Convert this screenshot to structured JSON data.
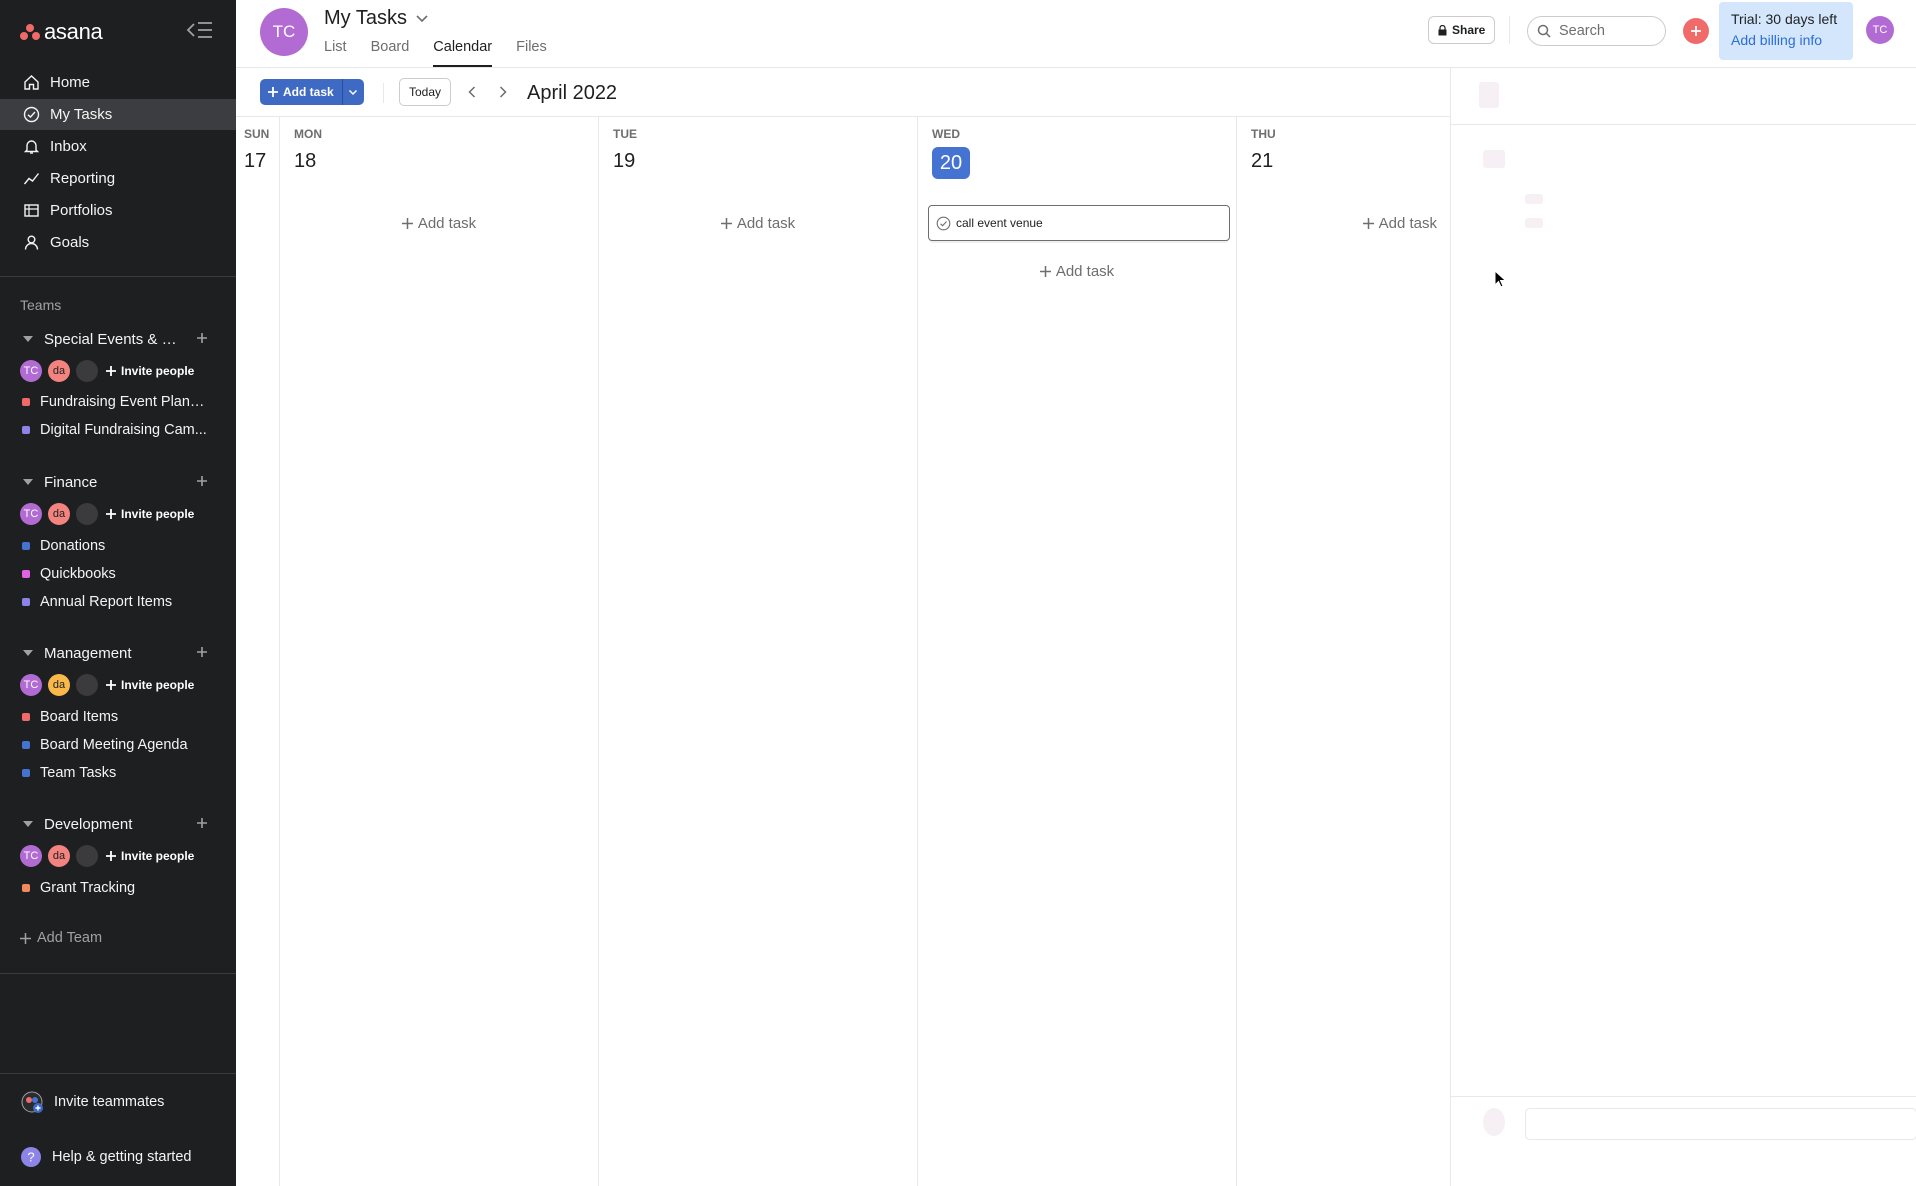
{
  "app": {
    "brand": "asana"
  },
  "sidebar": {
    "nav": [
      {
        "label": "Home",
        "icon": "home-icon"
      },
      {
        "label": "My Tasks",
        "icon": "check-circle-icon"
      },
      {
        "label": "Inbox",
        "icon": "bell-icon"
      },
      {
        "label": "Reporting",
        "icon": "trend-line-icon"
      },
      {
        "label": "Portfolios",
        "icon": "folder-icon"
      },
      {
        "label": "Goals",
        "icon": "person-icon"
      }
    ],
    "teams_label": "Teams",
    "teams": [
      {
        "name": "Special Events & Ma...",
        "invite": "Invite people",
        "members": [
          "TC",
          "da"
        ],
        "projects": [
          {
            "name": "Fundraising Event Planni...",
            "color": "#f06a6a"
          },
          {
            "name": "Digital Fundraising Cam...",
            "color": "#8d84e8"
          }
        ]
      },
      {
        "name": "Finance",
        "invite": "Invite people",
        "members": [
          "TC",
          "da"
        ],
        "projects": [
          {
            "name": "Donations",
            "color": "#4573d2"
          },
          {
            "name": "Quickbooks",
            "color": "#e362e3"
          },
          {
            "name": "Annual Report Items",
            "color": "#8d84e8"
          }
        ]
      },
      {
        "name": "Management",
        "invite": "Invite people",
        "members": [
          "TC",
          "da"
        ],
        "projects": [
          {
            "name": "Board Items",
            "color": "#f06a6a"
          },
          {
            "name": "Board Meeting Agenda",
            "color": "#4573d2"
          },
          {
            "name": "Team Tasks",
            "color": "#4573d2"
          }
        ]
      },
      {
        "name": "Development",
        "invite": "Invite people",
        "members": [
          "TC",
          "da"
        ],
        "projects": [
          {
            "name": "Grant Tracking",
            "color": "#f1895c"
          }
        ]
      }
    ],
    "add_team": "Add Team",
    "invite_teammates": "Invite teammates",
    "help": "Help & getting started"
  },
  "header": {
    "avatar_initials": "TC",
    "title": "My Tasks",
    "tabs": [
      "List",
      "Board",
      "Calendar",
      "Files"
    ],
    "active_tab": "Calendar",
    "share_label": "Share",
    "search_placeholder": "Search",
    "trial_text": "Trial: 30 days left",
    "billing_text": "Add billing info",
    "user_initials": "TC"
  },
  "toolbar": {
    "add_task_label": "Add task",
    "today_label": "Today",
    "month_label": "April 2022"
  },
  "calendar": {
    "days": [
      {
        "name": "SUN",
        "num": "17"
      },
      {
        "name": "MON",
        "num": "18",
        "add": "Add task"
      },
      {
        "name": "TUE",
        "num": "19",
        "add": "Add task"
      },
      {
        "name": "WED",
        "num": "20",
        "add": "Add task",
        "today": true,
        "task": "call event venue"
      },
      {
        "name": "THU",
        "num": "21",
        "add": "Add task"
      }
    ]
  },
  "colors": {
    "sidebar_bg": "#1e1f21",
    "accent": "#4573d2",
    "brand": "#f06a6a",
    "trial_bg": "#d4e6fb"
  }
}
